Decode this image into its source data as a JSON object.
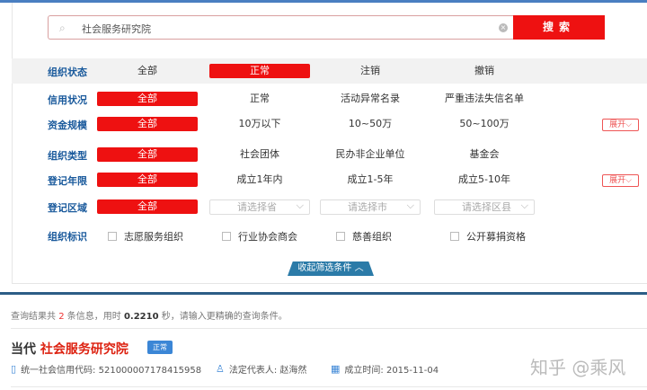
{
  "search": {
    "value": "社会服务研究院",
    "button": "搜索"
  },
  "filters": [
    {
      "label": "组织状态",
      "options": [
        "全部",
        "正常",
        "注销",
        "撤销"
      ],
      "selected": 1
    },
    {
      "label": "信用状况",
      "options": [
        "全部",
        "正常",
        "活动异常名录",
        "严重违法失信名单"
      ],
      "selected": 0
    },
    {
      "label": "资金规模",
      "options": [
        "全部",
        "10万以下",
        "10~50万",
        "50~100万"
      ],
      "selected": 0,
      "expand": "展开"
    },
    {
      "label": "组织类型",
      "options": [
        "全部",
        "社会团体",
        "民办非企业单位",
        "基金会"
      ],
      "selected": 0
    },
    {
      "label": "登记年限",
      "options": [
        "全部",
        "成立1年内",
        "成立1-5年",
        "成立5-10年"
      ],
      "selected": 0,
      "expand": "展开"
    },
    {
      "label": "登记区域",
      "options": [
        "全部"
      ],
      "selects": [
        "请选择省",
        "请选择市",
        "请选择区县"
      ],
      "selected": 0
    },
    {
      "label": "组织标识",
      "checkboxes": [
        "志愿服务组织",
        "行业协会商会",
        "慈善组织",
        "公开募捐资格"
      ]
    }
  ],
  "collapse": "收起筛选条件",
  "result_info": {
    "prefix": "查询结果共",
    "count": "2",
    "mid": "条信息，用时",
    "time": "0.2210",
    "suffix": "秒，请输入更精确的查询条件。"
  },
  "result": {
    "prefix": "当代",
    "name": "社会服务研究院",
    "status": "正常",
    "credit_code": "统一社会信用代码: 521000007178415958",
    "rep": "法定代表人: 赵海然",
    "date": "成立时间: 2015-11-04"
  },
  "watermark": "知乎 @乘风"
}
